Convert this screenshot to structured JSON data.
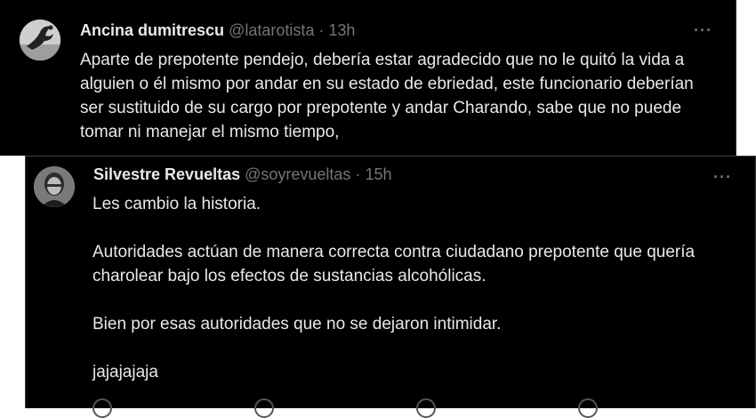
{
  "tweets": [
    {
      "name": "Ancina dumitrescu",
      "handle": "@latarotista",
      "separator": "·",
      "time": "13h",
      "more": "···",
      "text": [
        "Aparte de prepotente pendejo,  debería estar agradecido que no le quitó la vida a alguien o él mismo por andar en su estado de ebriedad, este funcionario deberían  ser sustituido de su cargo por prepotente y andar Charando, sabe que no puede tomar ni manejar el mismo tiempo,"
      ]
    },
    {
      "name": "Silvestre Revueltas",
      "handle": "@soyrevueltas",
      "separator": "·",
      "time": "15h",
      "more": "···",
      "text": [
        "Les cambio la historia.",
        "Autoridades actúan de manera correcta contra ciudadano prepotente que quería charolear bajo los efectos de sustancias alcohólicas.",
        "Bien por esas autoridades que no se dejaron intimidar.",
        "jajajajaja"
      ]
    }
  ],
  "colors": {
    "background": "#000000",
    "text": "#e7e9ea",
    "muted": "#71767b"
  }
}
